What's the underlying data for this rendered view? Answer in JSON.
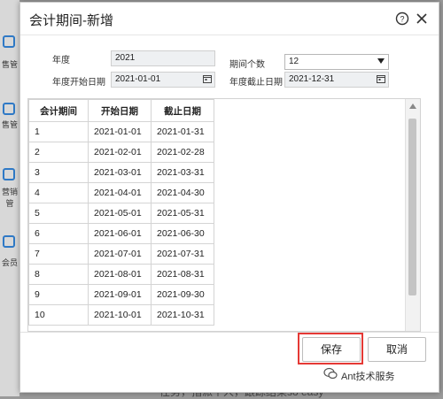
{
  "background": {
    "side_labels": [
      "售管",
      "售管",
      "营销管",
      "会员"
    ],
    "bottom_text": "任务，指派个人，跟踪结果so easy"
  },
  "dialog": {
    "title": "会计期间-新增",
    "help_icon": "help-circle-icon",
    "close_icon": "close-icon"
  },
  "form": {
    "year_label": "年度",
    "year_value": "2021",
    "period_count_label": "期间个数",
    "period_count_value": "12",
    "start_label": "年度开始日期",
    "start_value": "2021-01-01",
    "end_label": "年度截止日期",
    "end_value": "2021-12-31"
  },
  "table": {
    "headers": [
      "会计期间",
      "开始日期",
      "截止日期"
    ],
    "rows": [
      [
        "1",
        "2021-01-01",
        "2021-01-31"
      ],
      [
        "2",
        "2021-02-01",
        "2021-02-28"
      ],
      [
        "3",
        "2021-03-01",
        "2021-03-31"
      ],
      [
        "4",
        "2021-04-01",
        "2021-04-30"
      ],
      [
        "5",
        "2021-05-01",
        "2021-05-31"
      ],
      [
        "6",
        "2021-06-01",
        "2021-06-30"
      ],
      [
        "7",
        "2021-07-01",
        "2021-07-31"
      ],
      [
        "8",
        "2021-08-01",
        "2021-08-31"
      ],
      [
        "9",
        "2021-09-01",
        "2021-09-30"
      ],
      [
        "10",
        "2021-10-01",
        "2021-10-31"
      ]
    ]
  },
  "buttons": {
    "save_label": "保存",
    "cancel_label": "取消"
  },
  "watermark": "Ant技术服务",
  "colors": {
    "highlight": "#e53935",
    "accent": "#2f79c6"
  }
}
